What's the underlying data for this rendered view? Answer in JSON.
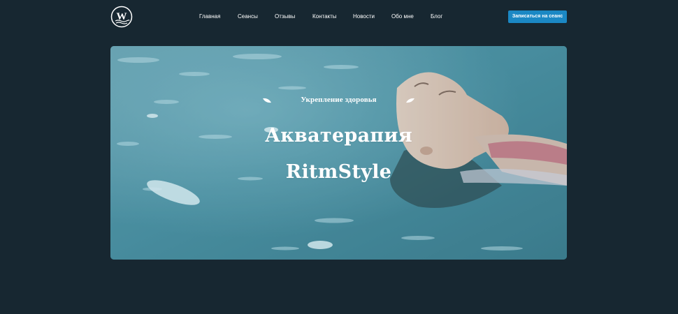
{
  "header": {
    "logo_icon": "logo-w-waves-icon",
    "nav": [
      {
        "label": "Главная"
      },
      {
        "label": "Сеансы"
      },
      {
        "label": "Отзывы"
      },
      {
        "label": "Контакты"
      },
      {
        "label": "Новости"
      },
      {
        "label": "Обо мне"
      },
      {
        "label": "Блог"
      }
    ],
    "cta_label": "Записаться на сеанс"
  },
  "hero": {
    "eyebrow": "Укрепление здоровья",
    "title_line1": "Акватерапия",
    "title_line2": "RitmStyle",
    "leaf_icon": "leaf-icon"
  },
  "colors": {
    "background": "#172731",
    "accent": "#1b88c4",
    "text": "#ffffff"
  }
}
